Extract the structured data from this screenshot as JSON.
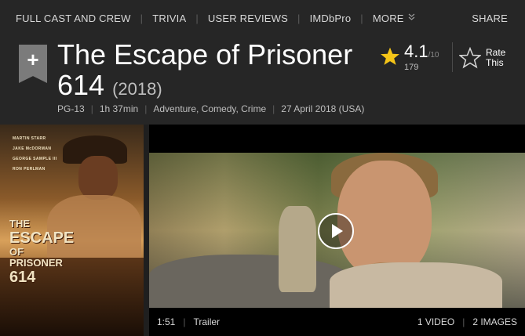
{
  "nav": {
    "items": [
      "FULL CAST AND CREW",
      "TRIVIA",
      "USER REVIEWS",
      "IMDbPro"
    ],
    "more_label": "MORE",
    "share_label": "SHARE"
  },
  "title": {
    "watchlist_icon": "+",
    "name": "The Escape of Prisoner 614",
    "year": "(2018)"
  },
  "meta": {
    "rating": "PG-13",
    "runtime": "1h 37min",
    "genres": "Adventure, Comedy, Crime",
    "release": "27 April 2018 (USA)"
  },
  "rating": {
    "value": "4.1",
    "max": "/10",
    "count": "179",
    "star_color": "#f5c518"
  },
  "rate_this": {
    "line1": "Rate",
    "line2": "This"
  },
  "poster": {
    "credits": [
      "MARTIN STARR",
      "JAKE McDORMAN",
      "GEORGE SAMPLE III",
      "RON PERLMAN"
    ],
    "title_line1": "THE",
    "title_line2": "ESCAPE",
    "title_line3": "OF",
    "title_line4": "PRISONER",
    "title_line5": "614"
  },
  "video": {
    "duration": "1:51",
    "type": "Trailer",
    "videos_count": "1 VIDEO",
    "images_count": "2 IMAGES"
  }
}
